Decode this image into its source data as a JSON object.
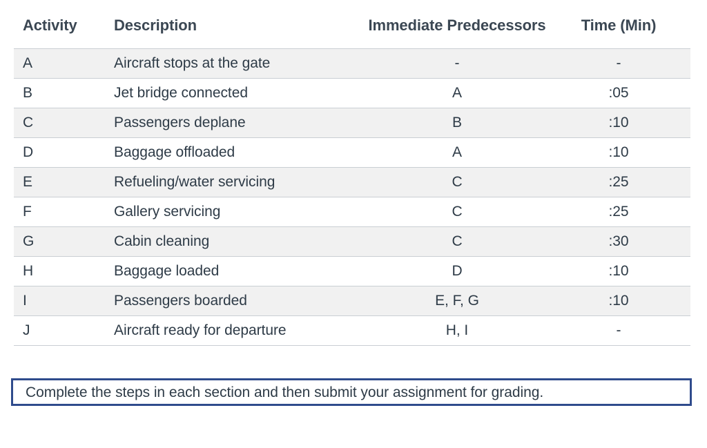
{
  "table": {
    "columns": [
      {
        "key": "activity",
        "label": "Activity"
      },
      {
        "key": "description",
        "label": "Description"
      },
      {
        "key": "predecessors",
        "label": "Immediate Predecessors"
      },
      {
        "key": "time",
        "label": "Time (Min)"
      }
    ],
    "rows": [
      {
        "activity": "A",
        "description": "Aircraft stops at the gate",
        "predecessors": "-",
        "time": "-"
      },
      {
        "activity": "B",
        "description": "Jet bridge connected",
        "predecessors": "A",
        "time": ":05"
      },
      {
        "activity": "C",
        "description": "Passengers deplane",
        "predecessors": "B",
        "time": ":10"
      },
      {
        "activity": "D",
        "description": "Baggage offloaded",
        "predecessors": "A",
        "time": ":10"
      },
      {
        "activity": "E",
        "description": "Refueling/water servicing",
        "predecessors": "C",
        "time": ":25"
      },
      {
        "activity": "F",
        "description": "Gallery servicing",
        "predecessors": "C",
        "time": ":25"
      },
      {
        "activity": "G",
        "description": "Cabin cleaning",
        "predecessors": "C",
        "time": ":30"
      },
      {
        "activity": "H",
        "description": "Baggage loaded",
        "predecessors": "D",
        "time": ":10"
      },
      {
        "activity": "I",
        "description": "Passengers boarded",
        "predecessors": "E, F, G",
        "time": ":10"
      },
      {
        "activity": "J",
        "description": "Aircraft ready for departure",
        "predecessors": "H, I",
        "time": "-"
      }
    ]
  },
  "callout": {
    "text": "Complete the steps in each section and then submit your assignment for grading.",
    "border_color": "#2f4b8c"
  },
  "colors": {
    "header_text": "#3b4753",
    "body_text": "#2e3b47",
    "row_stripe": "#f1f1f1",
    "row_plain": "#ffffff",
    "row_border": "#c9ced3",
    "page_background": "#ffffff"
  }
}
